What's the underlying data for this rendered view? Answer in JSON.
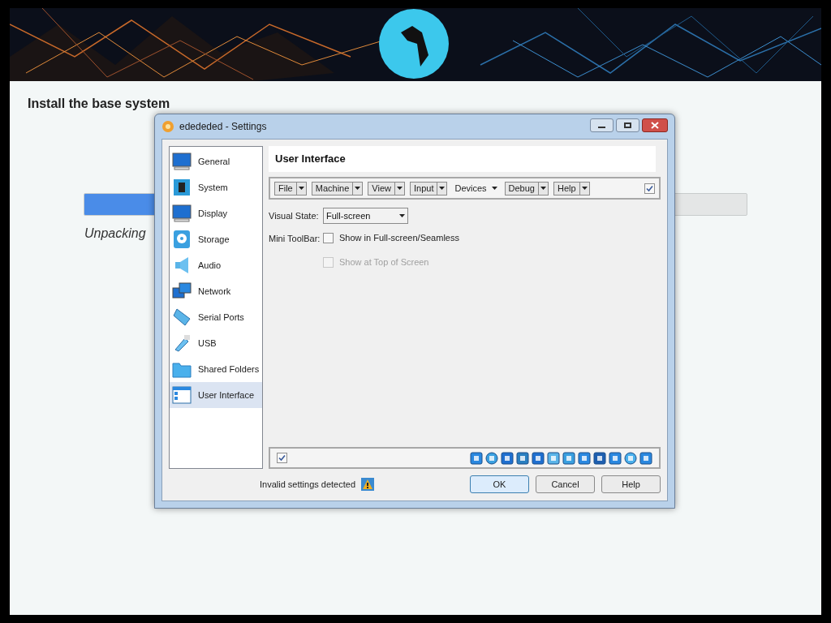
{
  "installer": {
    "heading": "Install the base system",
    "progress": {
      "level": 0.3
    },
    "status": "Unpacking"
  },
  "dialog": {
    "title": "edededed - Settings",
    "sidebar": {
      "items": [
        {
          "label": "General",
          "selected": false
        },
        {
          "label": "System",
          "selected": false
        },
        {
          "label": "Display",
          "selected": false
        },
        {
          "label": "Storage",
          "selected": false
        },
        {
          "label": "Audio",
          "selected": false
        },
        {
          "label": "Network",
          "selected": false
        },
        {
          "label": "Serial Ports",
          "selected": false
        },
        {
          "label": "USB",
          "selected": false
        },
        {
          "label": "Shared Folders",
          "selected": false
        },
        {
          "label": "User Interface",
          "selected": true
        }
      ]
    },
    "page_title": "User Interface",
    "menu_bar": {
      "items": [
        {
          "label": "File",
          "kind": "boxed"
        },
        {
          "label": "Machine",
          "kind": "boxed"
        },
        {
          "label": "View",
          "kind": "boxed"
        },
        {
          "label": "Input",
          "kind": "boxed"
        },
        {
          "label": "Devices",
          "kind": "plain"
        },
        {
          "label": "Debug",
          "kind": "boxed"
        },
        {
          "label": "Help",
          "kind": "boxed"
        }
      ],
      "enabled_checked": true
    },
    "visual_state": {
      "label": "Visual State:",
      "value": "Full-screen"
    },
    "mini_toolbar": {
      "label": "Mini ToolBar:",
      "options": [
        {
          "label": "Show in Full-screen/Seamless",
          "checked": false,
          "disabled": false
        },
        {
          "label": "Show at Top of Screen",
          "checked": false,
          "disabled": true
        }
      ]
    },
    "status_bar": {
      "enabled_checked": true
    },
    "footer": {
      "warning": "Invalid settings detected",
      "buttons": [
        {
          "label": "OK",
          "selected": true
        },
        {
          "label": "Cancel",
          "selected": false
        },
        {
          "label": "Help",
          "selected": false
        }
      ]
    }
  }
}
